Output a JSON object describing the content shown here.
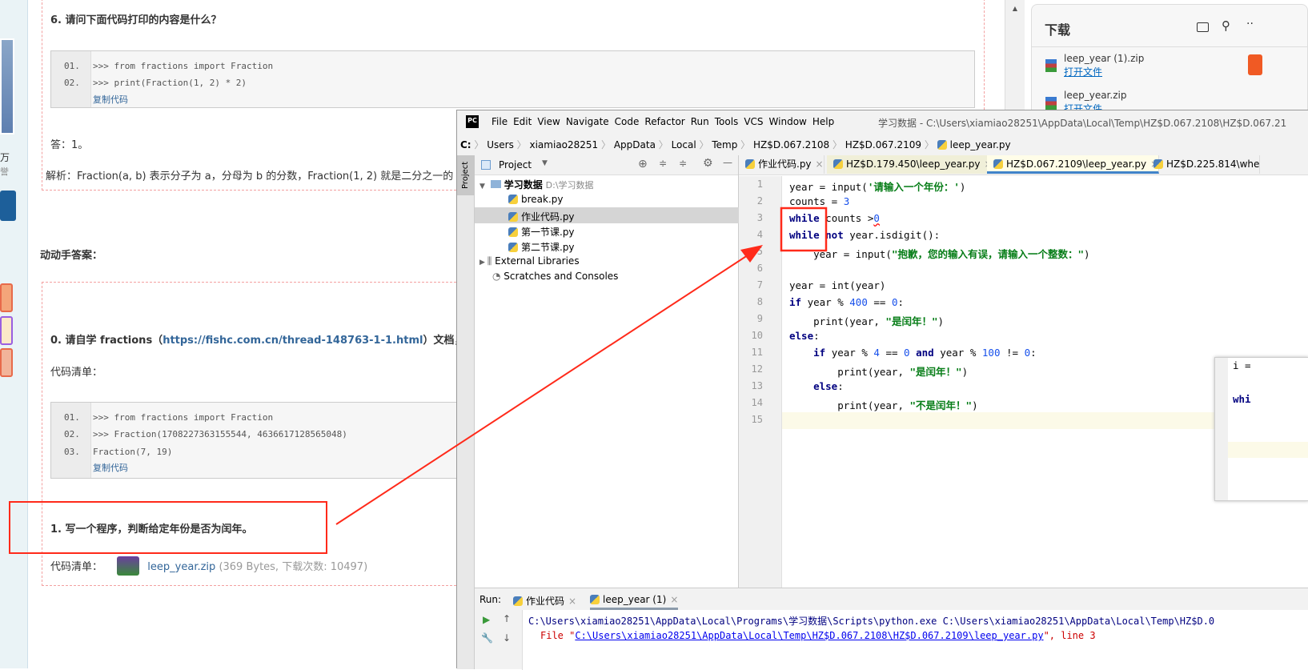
{
  "page": {
    "q6_title": "6. 请问下面代码打印的内容是什么？",
    "q6_code": [
      {
        "n": "01.",
        "t": ">>> from fractions import Fraction"
      },
      {
        "n": "02.",
        "t": ">>> print(Fraction(1, 2) * 2)"
      }
    ],
    "copy_code": "复制代码",
    "q6_answer": "答：1。",
    "q6_explain": "解析：Fraction(a, b) 表示分子为 a，分母为 b 的分数，Fraction(1, 2) 就是二分之一的",
    "sidebar_text1": "万",
    "sidebar_text2": "誉",
    "hands_on": "动动手答案：",
    "q0_prefix": "0. 请自学 fractions（",
    "q0_link": "https://fishc.com.cn/thread-148763-1-1.html",
    "q0_suffix": "）文档，并",
    "code_list_label": "代码清单：",
    "q0_code": [
      {
        "n": "01.",
        "t": ">>> from fractions import Fraction"
      },
      {
        "n": "02.",
        "t": ">>> Fraction(1708227363155544, 4636617128565048)"
      },
      {
        "n": "03.",
        "t": "Fraction(7, 19)"
      }
    ],
    "q1_title": "1. 写一个程序，判断给定年份是否为闰年。",
    "q1_code_label": "代码清单：",
    "q1_file": "leep_year.zip",
    "q1_file_meta": "(369 Bytes, 下载次数: 10497)"
  },
  "downloads": {
    "title": "下载",
    "items": [
      {
        "name": "leep_year (1).zip",
        "action": "打开文件"
      },
      {
        "name": "leep_year.zip",
        "action": "打开文件"
      }
    ]
  },
  "ide": {
    "logo": "PC",
    "menu": [
      "File",
      "Edit",
      "View",
      "Navigate",
      "Code",
      "Refactor",
      "Run",
      "Tools",
      "VCS",
      "Window",
      "Help"
    ],
    "title": "学习数据 - C:\\Users\\xiamiao28251\\AppData\\Local\\Temp\\HZ$D.067.2108\\HZ$D.067.21",
    "breadcrumb": [
      "C:",
      "Users",
      "xiamiao28251",
      "AppData",
      "Local",
      "Temp",
      "HZ$D.067.2108",
      "HZ$D.067.2109",
      "leep_year.py"
    ],
    "side_stripe": "Project",
    "project_label": "Project",
    "tree": {
      "root": "学习数据",
      "root_path": "D:\\学习数据",
      "files": [
        "break.py",
        "作业代码.py",
        "第一节课.py",
        "第二节课.py"
      ],
      "external": "External Libraries",
      "scratches": "Scratches and Consoles"
    },
    "tabs": [
      "作业代码.py",
      "HZ$D.179.450\\leep_year.py",
      "HZ$D.067.2109\\leep_year.py",
      "HZ$D.225.814\\whe"
    ],
    "active_tab": 2,
    "lines": [
      "1",
      "2",
      "3",
      "4",
      "5",
      "6",
      "7",
      "8",
      "9",
      "10",
      "11",
      "12",
      "13",
      "14",
      "15"
    ],
    "float_code": [
      "i =",
      "whi"
    ],
    "run": {
      "label": "Run:",
      "tabs": [
        "作业代码",
        "leep_year (1)"
      ],
      "out1": "C:\\Users\\xiamiao28251\\AppData\\Local\\Programs\\学习数据\\Scripts\\python.exe C:\\Users\\xiamiao28251\\AppData\\Local\\Temp\\HZ$D.0",
      "out2_pre": "File \"",
      "out2_link": "C:\\Users\\xiamiao28251\\AppData\\Local\\Temp\\HZ$D.067.2108\\HZ$D.067.2109\\leep_year.py",
      "out2_post": "\", line 3"
    }
  },
  "annotation_color": "#ff2a1a"
}
